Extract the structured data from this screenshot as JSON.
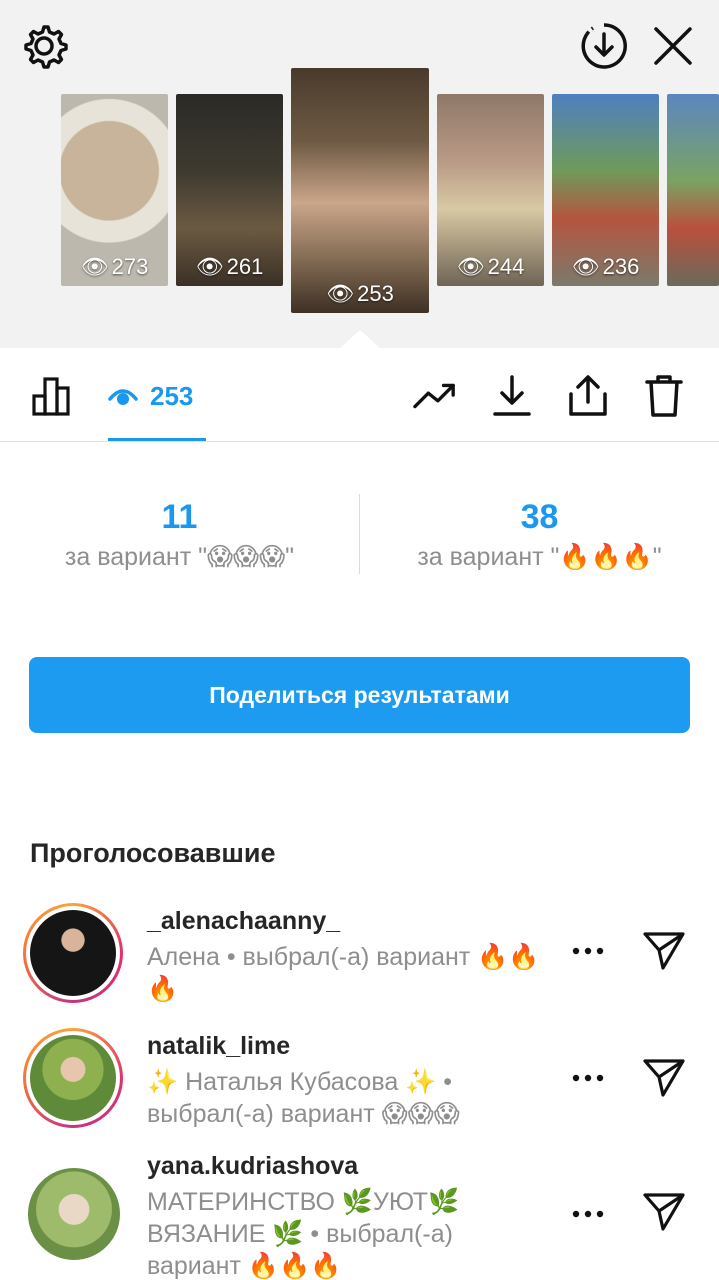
{
  "header": {
    "settings_icon": "gear-icon",
    "download_icon": "download-circle-icon",
    "close_icon": "close-icon"
  },
  "stories": [
    {
      "views": "273"
    },
    {
      "views": "261"
    },
    {
      "views": "253",
      "selected": true
    },
    {
      "views": "244"
    },
    {
      "views": "236"
    },
    {
      "views": ""
    }
  ],
  "toolbar": {
    "viewers_count": "253",
    "icons": [
      "bar-chart-icon",
      "eye-icon",
      "trending-icon",
      "download-icon",
      "share-icon",
      "trash-icon"
    ]
  },
  "poll": {
    "left": {
      "count": "11",
      "label": "за вариант \"😱😱😱\""
    },
    "right": {
      "count": "38",
      "label": "за вариант \"🔥🔥🔥\""
    }
  },
  "share_button": "Поделиться результатами",
  "voters": {
    "title": "Проголосовавшие",
    "items": [
      {
        "username": "_alenachaanny_",
        "subtitle": "Алена • выбрал(-а) вариант 🔥🔥🔥"
      },
      {
        "username": "natalik_lime",
        "subtitle": "✨ Наталья Кубасова ✨ • выбрал(-а) вариант 😱😱😱"
      },
      {
        "username": "yana.kudriashova",
        "subtitle": "МАТЕРИНСТВО 🌿УЮТ🌿 ВЯЗАНИЕ 🌿 • выбрал(-а) вариант 🔥🔥🔥"
      }
    ]
  },
  "colors": {
    "accent": "#1a98f0",
    "button": "#1d9bf0",
    "muted_text": "#8e8e8e",
    "top_bg": "#f2f2f2"
  }
}
